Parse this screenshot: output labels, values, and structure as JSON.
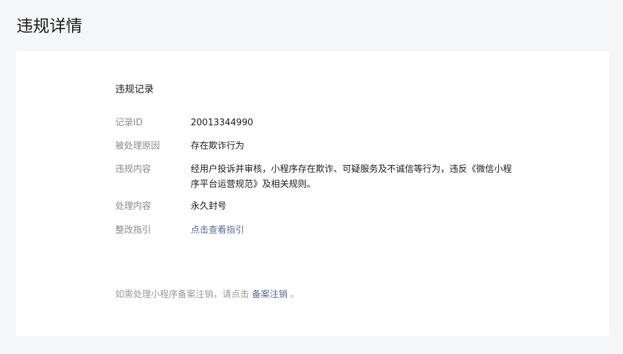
{
  "page": {
    "title": "违规详情"
  },
  "record": {
    "section_title": "违规记录",
    "rows": [
      {
        "label": "记录ID",
        "value": "20013344990"
      },
      {
        "label": "被处理原因",
        "value": "存在欺诈行为"
      },
      {
        "label": "违规内容",
        "value": "经用户投诉并审核，小程序存在欺诈、可疑服务及不诚信等行为，违反《微信小程序平台运营规范》及相关规则。"
      },
      {
        "label": "处理内容",
        "value": "永久封号"
      },
      {
        "label": "整改指引",
        "value": "点击查看指引"
      }
    ]
  },
  "footer": {
    "prefix": "如需处理小程序备案注销，请点击 ",
    "link": "备案注销",
    "suffix": " 。"
  },
  "colors": {
    "background": "#f5f6f7",
    "card": "#ffffff",
    "text": "#1a1a1a",
    "label": "#888888",
    "link": "#576b95"
  }
}
